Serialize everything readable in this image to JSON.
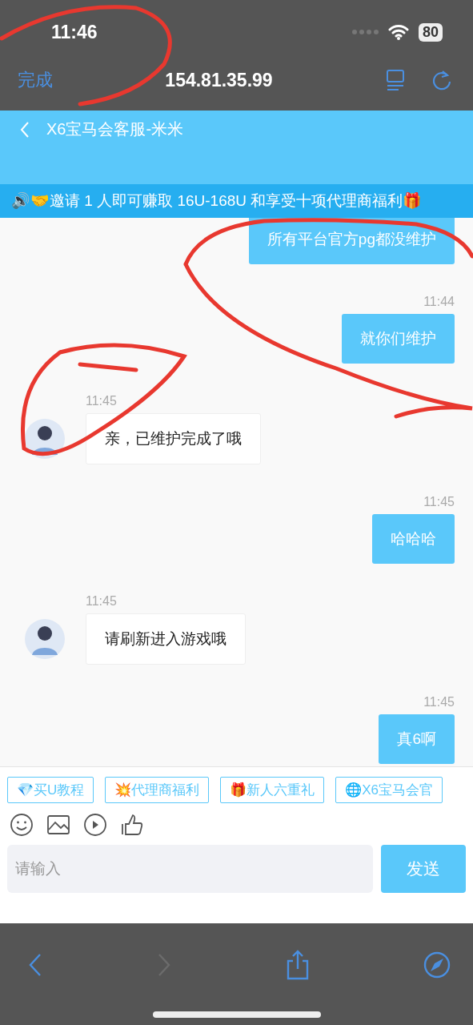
{
  "status_bar": {
    "time": "11:46",
    "battery": "80"
  },
  "browser_bar": {
    "done": "完成",
    "address": "154.81.35.99"
  },
  "header": {
    "title": "X6宝马会客服-米米"
  },
  "banner": {
    "text": "🔊🤝邀请 1 人即可赚取 16U-168U 和享受十项代理商福利🎁"
  },
  "messages": [
    {
      "kind": "sent",
      "text": "所有平台官方pg都没维护"
    },
    {
      "kind": "sent",
      "time": "11:44",
      "text": "就你们维护"
    },
    {
      "kind": "received",
      "time": "11:45",
      "text": "亲，已维护完成了哦"
    },
    {
      "kind": "sent",
      "time": "11:45",
      "text": "哈哈哈"
    },
    {
      "kind": "received",
      "time": "11:45",
      "text": "请刷新进入游戏哦"
    },
    {
      "kind": "sent",
      "time": "11:45",
      "text": "真6啊"
    }
  ],
  "quick_replies": [
    "💎买U教程",
    "💥代理商福利",
    "🎁新人六重礼",
    "🌐X6宝马会官"
  ],
  "input": {
    "placeholder": "请输入"
  },
  "send_button": "发送",
  "nav": {
    "back_disabled": false,
    "forward_disabled": true
  }
}
